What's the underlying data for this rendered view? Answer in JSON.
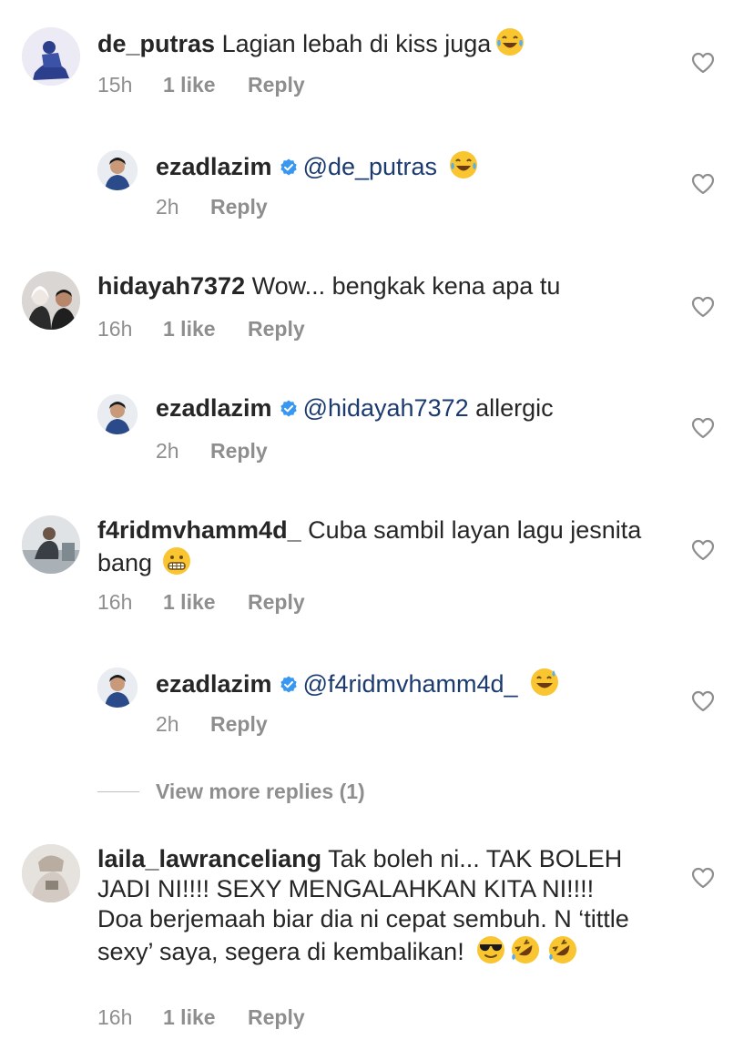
{
  "comments": [
    {
      "username": "de_putras",
      "text": "Lagian lebah di kiss juga",
      "emoji": [
        "joy-emoji"
      ],
      "time": "15h",
      "likes": "1 like",
      "reply_label": "Reply",
      "replies": [
        {
          "username": "ezadlazim",
          "verified": true,
          "mention": "@de_putras",
          "text": "",
          "emoji": [
            "joy-emoji"
          ],
          "time": "2h",
          "reply_label": "Reply"
        }
      ]
    },
    {
      "username": "hidayah7372",
      "text": "Wow... bengkak kena apa tu",
      "time": "16h",
      "likes": "1 like",
      "reply_label": "Reply",
      "replies": [
        {
          "username": "ezadlazim",
          "verified": true,
          "mention": "@hidayah7372",
          "text": "allergic",
          "time": "2h",
          "reply_label": "Reply"
        }
      ]
    },
    {
      "username": "f4ridmvhamm4d_",
      "text": "Cuba sambil layan lagu jesnita bang",
      "emoji": [
        "grimacing-emoji"
      ],
      "time": "16h",
      "likes": "1 like",
      "reply_label": "Reply",
      "replies": [
        {
          "username": "ezadlazim",
          "verified": true,
          "mention": "@f4ridmvhamm4d_",
          "text": "",
          "emoji": [
            "sweat-smile-emoji"
          ],
          "time": "2h",
          "reply_label": "Reply"
        }
      ],
      "view_more": "View more replies (1)"
    },
    {
      "username": "laila_lawranceliang",
      "text": "Tak boleh ni... TAK BOLEH JADI NI!!!! SEXY MENGALAHKAN KITA NI!!!! Doa berjemaah biar dia ni cepat sembuh. N ‘tittle sexy’ saya, segera di kembalikan!",
      "emoji": [
        "sunglasses-emoji",
        "rofl-emoji",
        "rofl-emoji"
      ],
      "time": "16h",
      "likes": "1 like",
      "reply_label": "Reply"
    }
  ],
  "colors": {
    "text": "#262626",
    "meta": "#8e8e8e",
    "mention": "#1b3b70",
    "verified": "#3897f0",
    "heart_outline": "#8e8e8e"
  }
}
